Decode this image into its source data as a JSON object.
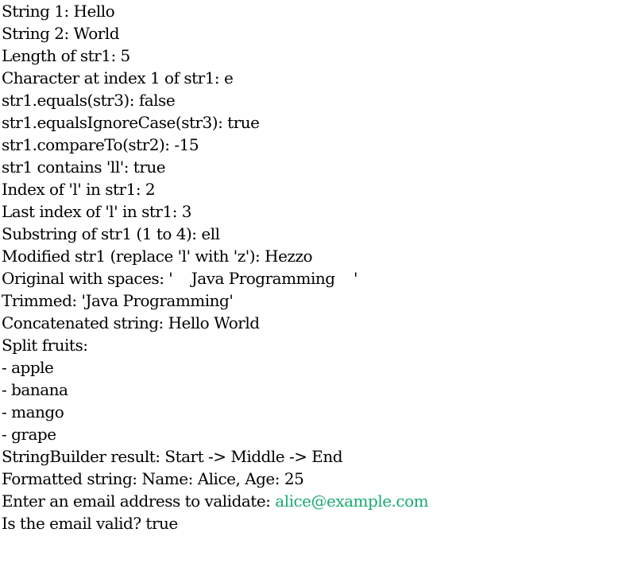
{
  "console": {
    "lines": [
      "String 1: Hello",
      "String 2: World",
      "Length of str1: 5",
      "Character at index 1 of str1: e",
      "str1.equals(str3): false",
      "str1.equalsIgnoreCase(str3): true",
      "str1.compareTo(str2): -15",
      "str1 contains 'll': true",
      "Index of 'l' in str1: 2",
      "Last index of 'l' in str1: 3",
      "Substring of str1 (1 to 4): ell",
      "Modified str1 (replace 'l' with 'z'): Hezzo",
      "Original with spaces: '    Java Programming    '",
      "Trimmed: 'Java Programming'",
      "Concatenated string: Hello World",
      "Split fruits:",
      "- apple",
      "- banana",
      "- mango",
      "- grape",
      "StringBuilder result: Start -> Middle -> End",
      "Formatted string: Name: Alice, Age: 25"
    ],
    "prompt": {
      "text": "Enter an email address to validate: ",
      "input_value": "alice@example.com",
      "input_color": "#1aaa6f"
    },
    "result": "Is the email valid? true"
  }
}
